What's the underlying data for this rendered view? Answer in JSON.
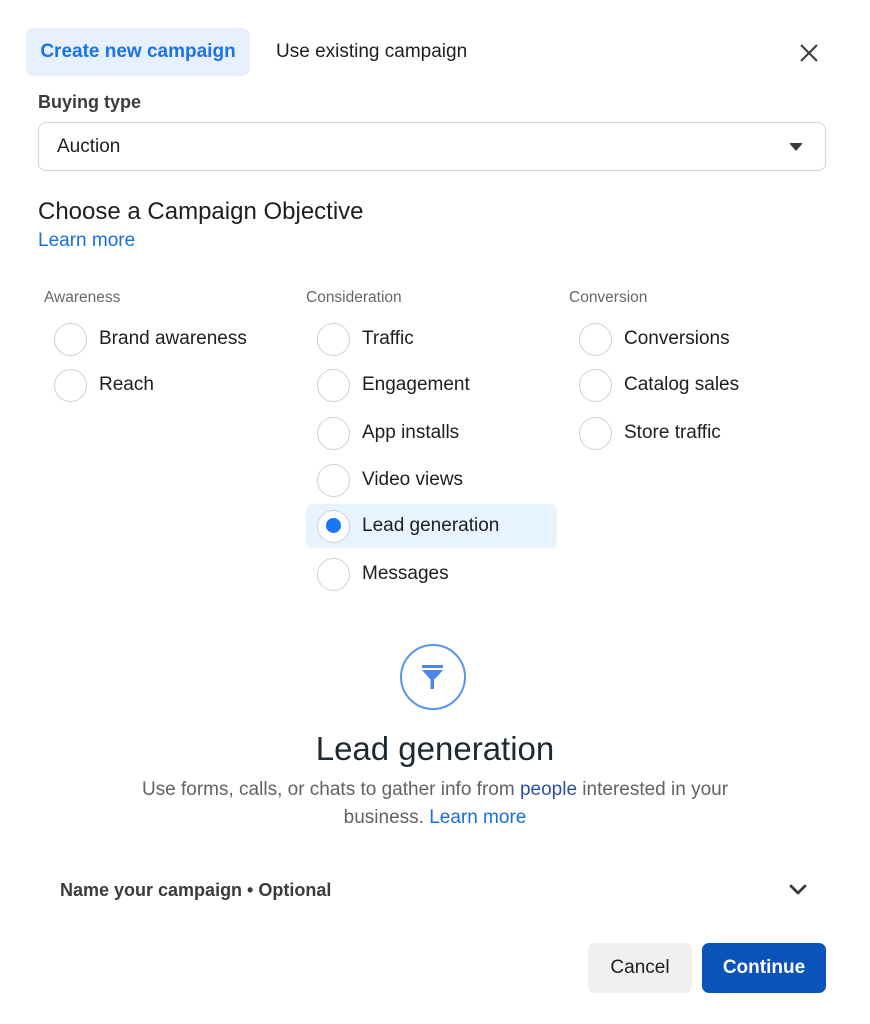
{
  "tabs": [
    {
      "label": "Create new campaign",
      "active": true
    },
    {
      "label": "Use existing campaign",
      "active": false
    }
  ],
  "close_icon": "close-icon",
  "buying_type": {
    "label": "Buying type",
    "selected_value": "Auction",
    "caret_icon": "caret-down-icon"
  },
  "objective": {
    "title": "Choose a Campaign Objective",
    "learn_more": "Learn more",
    "columns": [
      {
        "header": "Awareness",
        "options": [
          "Brand awareness",
          "Reach"
        ]
      },
      {
        "header": "Consideration",
        "options": [
          "Traffic",
          "Engagement",
          "App installs",
          "Video views",
          "Lead generation",
          "Messages"
        ]
      },
      {
        "header": "Conversion",
        "options": [
          "Conversions",
          "Catalog sales",
          "Store traffic"
        ]
      }
    ],
    "selected": "Lead generation"
  },
  "detail": {
    "icon": "funnel-icon",
    "title": "Lead generation",
    "desc_before": "Use forms, calls, or chats to gather info from ",
    "desc_link": "people",
    "desc_after": " interested in your business. ",
    "learn_more": "Learn more"
  },
  "name_campaign": {
    "label": "Name your campaign • Optional",
    "chevron_icon": "chevron-down-icon"
  },
  "footer": {
    "cancel_label": "Cancel",
    "continue_label": "Continue"
  },
  "colors": {
    "accent": "#1877f2",
    "primary_button": "#0b53b8",
    "selected_bg": "#e7f3ff"
  }
}
